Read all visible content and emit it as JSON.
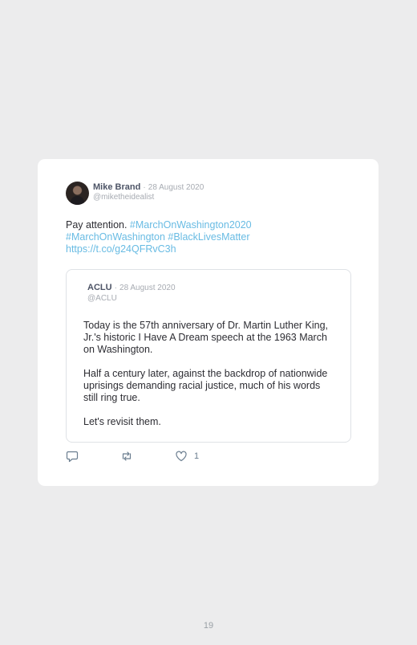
{
  "tweet": {
    "author_name": "Mike Brand",
    "separator": "·",
    "date": "28 August 2020",
    "handle": "@miketheidealist",
    "text_plain": "Pay attention. ",
    "hashtag_1": "#MarchOnWashington2020",
    "hashtag_2": "#MarchOnWashington",
    "hashtag_3": "#BlackLivesMatter",
    "url": "https://t.co/g24QFRvC3h"
  },
  "quoted_tweet": {
    "author_name": "ACLU",
    "separator": "·",
    "date": "28 August 2020",
    "handle": "@ACLU",
    "paragraphs": [
      "Today is the 57th anniversary of Dr. Martin Luther King, Jr.'s historic I Have A Dream speech at the 1963 March on Washington.",
      "Half a century later, against the backdrop of nationwide uprisings demanding racial justice, much of his words still ring true.",
      "Let's revisit them."
    ]
  },
  "actions": {
    "reply_icon": "reply-icon",
    "retweet_icon": "retweet-icon",
    "like_icon": "heart-icon",
    "like_count": "1"
  },
  "footer": {
    "page_number": "19"
  },
  "colors": {
    "background": "#ececed",
    "card": "#ffffff",
    "link": "#68bbe3",
    "muted": "#a7abb2",
    "icon": "#6a7d8f"
  }
}
